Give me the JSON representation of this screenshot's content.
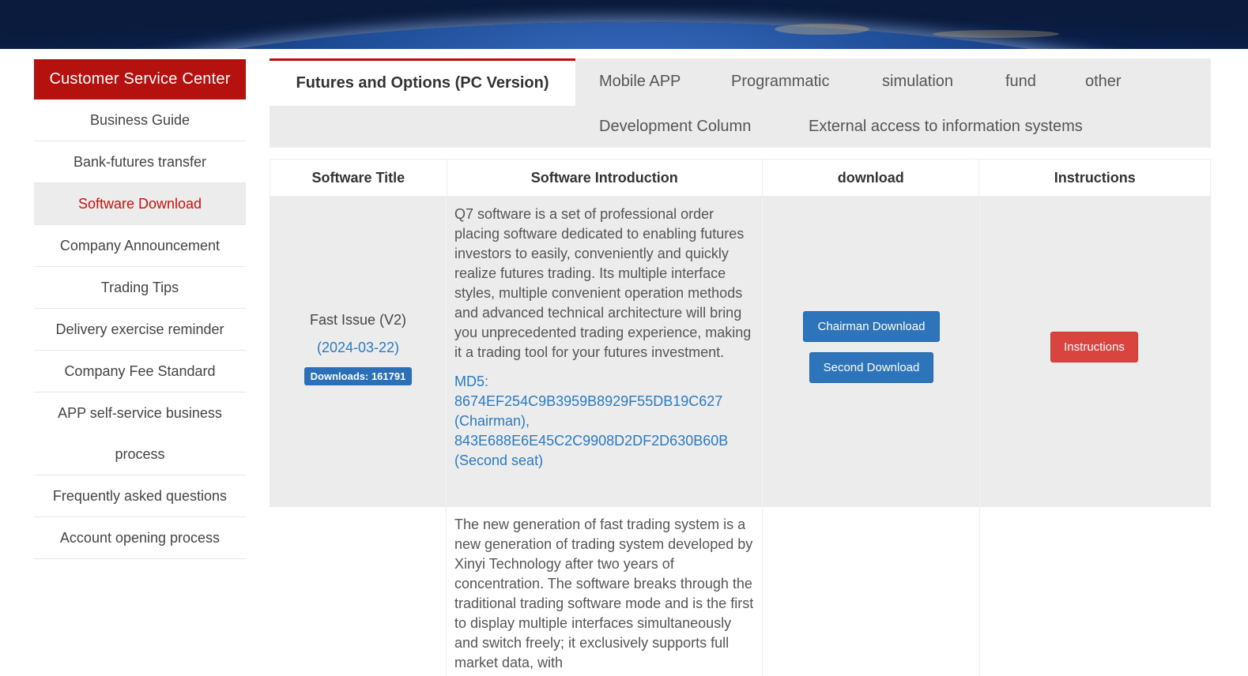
{
  "sidebar": {
    "header": "Customer Service Center",
    "items": [
      {
        "label": "Business Guide"
      },
      {
        "label": "Bank-futures transfer"
      },
      {
        "label": "Software Download"
      },
      {
        "label": "Company Announcement"
      },
      {
        "label": "Trading Tips"
      },
      {
        "label": "Delivery exercise reminder"
      },
      {
        "label": "Company Fee Standard"
      },
      {
        "label": "APP self-service business process"
      },
      {
        "label": "Frequently asked questions"
      },
      {
        "label": "Account opening process"
      }
    ],
    "active_index": 2
  },
  "tabs": {
    "active": "Futures and Options (PC Version)",
    "items": [
      "Mobile APP",
      "Programmatic",
      "simulation",
      "fund",
      "other",
      "Development Column",
      "External access to information systems"
    ]
  },
  "table": {
    "headers": [
      "Software Title",
      "Software Introduction",
      "download",
      "Instructions"
    ],
    "rows": [
      {
        "name": "Fast Issue (V2)",
        "date": "(2024-03-22)",
        "downloads": "Downloads: 161791",
        "intro": "Q7 software is a set of professional order placing software dedicated to enabling futures investors to easily, conveniently and quickly realize futures trading. Its multiple interface styles, multiple convenient operation methods and advanced technical architecture will bring you unprecedented trading experience, making it a trading tool for your futures investment.",
        "md5": "MD5: 8674EF254C9B3959B8929F55DB19C627 (Chairman), 843E688E6E45C2C9908D2DF2D630B60B (Second seat)",
        "download_buttons": [
          "Chairman Download",
          "Second Download"
        ],
        "instructions_button": "Instructions"
      },
      {
        "intro": "The new generation of fast trading system is a new generation of trading system developed by Xinyi Technology after two years of concentration. The software breaks through the traditional trading software mode and is the first to display multiple interfaces simultaneously and switch freely; it exclusively supports full market data, with"
      }
    ]
  }
}
